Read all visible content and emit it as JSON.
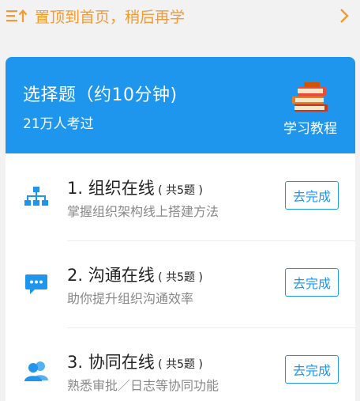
{
  "top_bar": {
    "icon": "pin-to-top-icon",
    "text": "置顶到首页，稍后再学",
    "chevron": "chevron-right-icon",
    "accent_color": "#f39a33"
  },
  "quiz": {
    "title": "选择题（约10分钟)",
    "participants": "21万人考过",
    "tutorial_label": "学习教程",
    "header_color": "#1e96ee"
  },
  "items": [
    {
      "title": "1. 组织在线",
      "count": " ( 共5题 )",
      "description": "掌握组织架构线上搭建方法",
      "button": "去完成",
      "icon": "org-chart-icon"
    },
    {
      "title": "2. 沟通在线",
      "count": " ( 共5题 )",
      "description": "助你提升组织沟通效率",
      "button": "去完成",
      "icon": "chat-bubble-icon"
    },
    {
      "title": "3. 协同在线",
      "count": " ( 共5题 )",
      "description": "熟悉审批／日志等协同功能",
      "button": "去完成",
      "icon": "people-icon"
    }
  ]
}
